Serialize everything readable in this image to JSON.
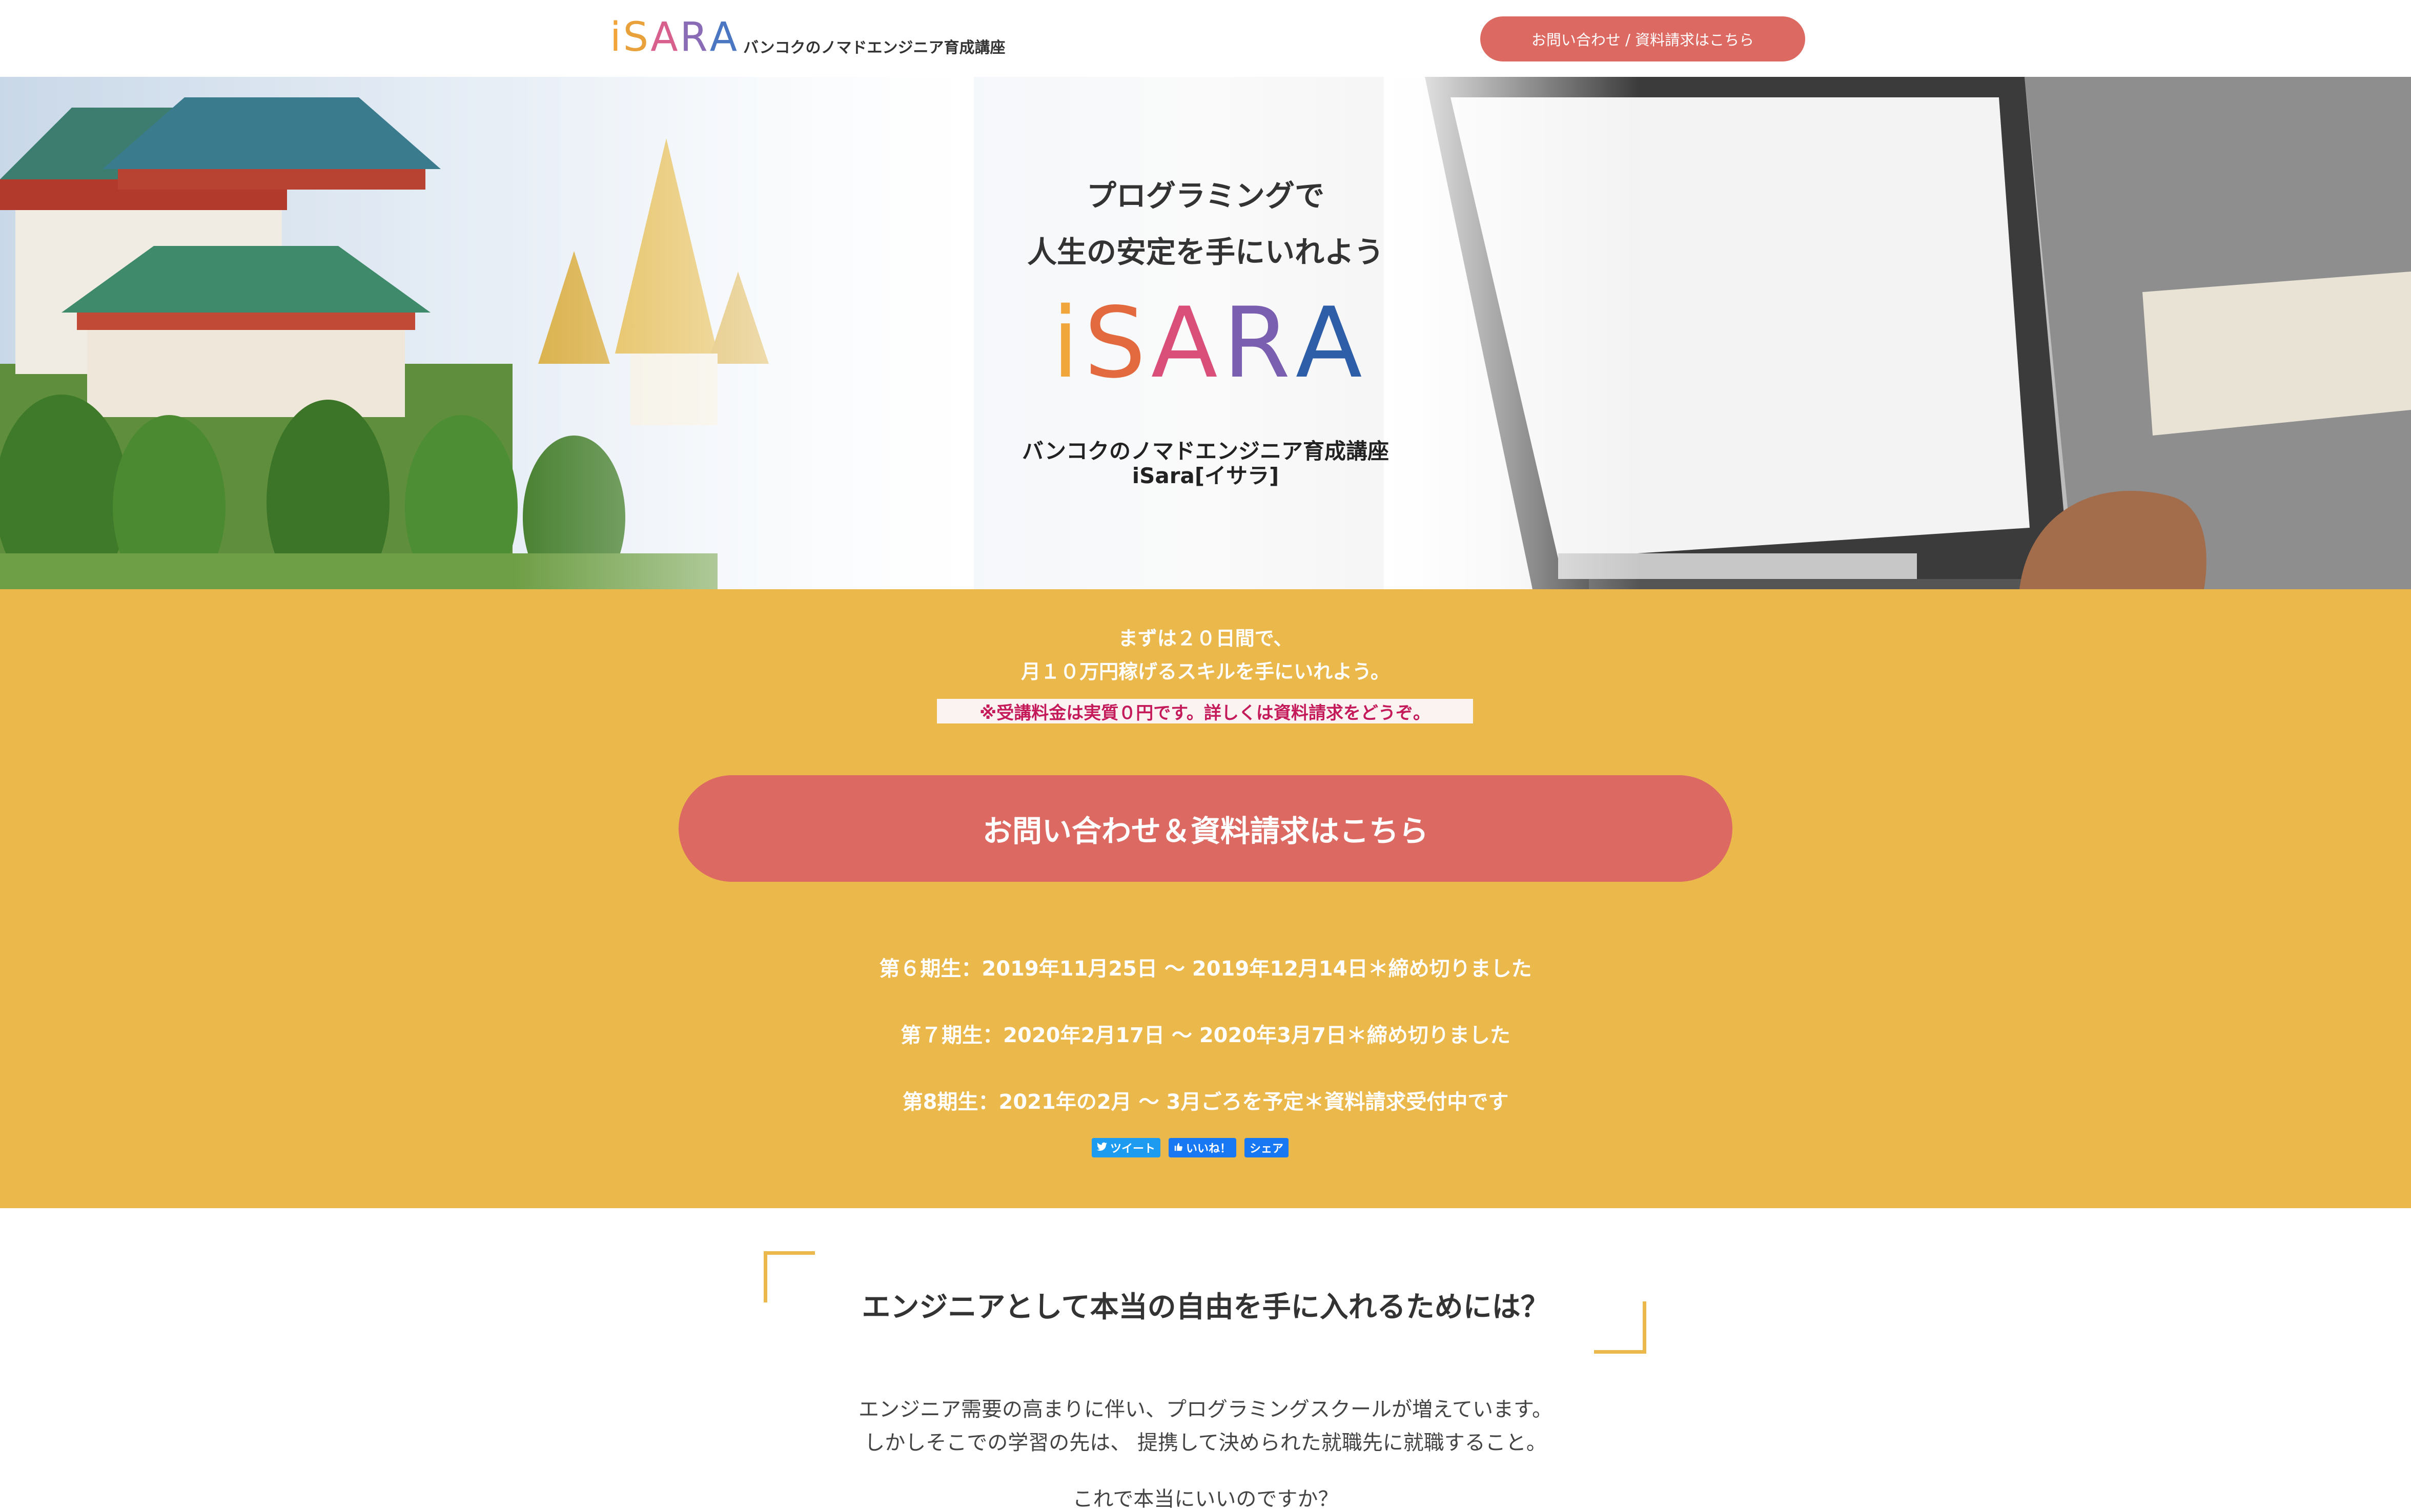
{
  "header": {
    "logo_letters": [
      {
        "ch": "i",
        "color": "#f2a33a"
      },
      {
        "ch": "S",
        "color": "#e9a23b"
      },
      {
        "ch": "A",
        "color": "#d8608c"
      },
      {
        "ch": "R",
        "color": "#8a6bb5"
      },
      {
        "ch": "A",
        "color": "#4b77c2"
      }
    ],
    "tagline": "バンコクのノマドエンジニア育成講座",
    "contact_button": "お問い合わせ / 資料請求はこちら"
  },
  "hero": {
    "title_line1": "プログラミングで",
    "title_line2": "人生の安定を手にいれよう",
    "logo_letters": [
      {
        "ch": "i",
        "color": "#f0a63a"
      },
      {
        "ch": "S",
        "color": "#e36a3f"
      },
      {
        "ch": "A",
        "color": "#d94f7a"
      },
      {
        "ch": "R",
        "color": "#7a5fb1"
      },
      {
        "ch": "A",
        "color": "#2f5ea8"
      }
    ],
    "subtitle_line1": "バンコクのノマドエンジニア育成講座",
    "subtitle_line2": "iSara[イサラ]"
  },
  "cta": {
    "line1": "まずは２０日間で、",
    "line2": "月１０万円稼げるスキルを手にいれよう。",
    "note": "※受講料金は実質０円です。詳しくは資料請求をどうぞ。",
    "button": "お問い合わせ＆資料請求はこちら",
    "terms": [
      "第６期生：2019年11月25日 ～ 2019年12月14日＊締め切りました",
      "第７期生：2020年2月17日 ～ 2020年3月7日＊締め切りました",
      "第8期生：2021年の2月 ～ 3月ごろを予定＊資料請求受付中です"
    ],
    "share": {
      "tweet": "ツイート",
      "like": "いいね！",
      "share": "シェア"
    }
  },
  "section2": {
    "title": "エンジニアとして本当の自由を手に入れるためには？",
    "paragraph1": "エンジニア需要の高まりに伴い、プログラミングスクールが増えています。",
    "paragraph2": "しかしそこでの学習の先は、 提携して決められた就職先に就職すること。",
    "paragraph3": "これで本当にいいのですか？"
  },
  "colors": {
    "accent": "#dc6a62",
    "band": "#eab84b",
    "note_text": "#c41a5a",
    "twitter": "#1d9bf0",
    "facebook": "#1877f2"
  }
}
